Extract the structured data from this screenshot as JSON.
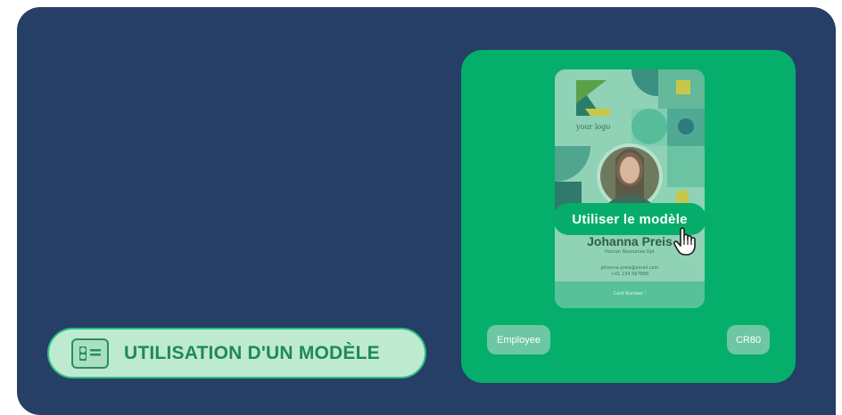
{
  "feature": {
    "label": "UTILISATION D'UN MODÈLE",
    "icon": "id-card-icon"
  },
  "template_card": {
    "logo_text": "your logo",
    "name": "Johanna Preis",
    "department": "Human Resources Dpt",
    "email": "johanna.preis@email.com",
    "phone": "+01 234 567890",
    "card_number": "Card Number :"
  },
  "actions": {
    "use_template": "Utiliser le modèle"
  },
  "tags": {
    "left": "Employee",
    "right": "CR80"
  },
  "colors": {
    "frame": "#253f66",
    "panel_green": "#05ae6b",
    "pill_bg": "#bfead2",
    "pill_text": "#1e8b55"
  }
}
